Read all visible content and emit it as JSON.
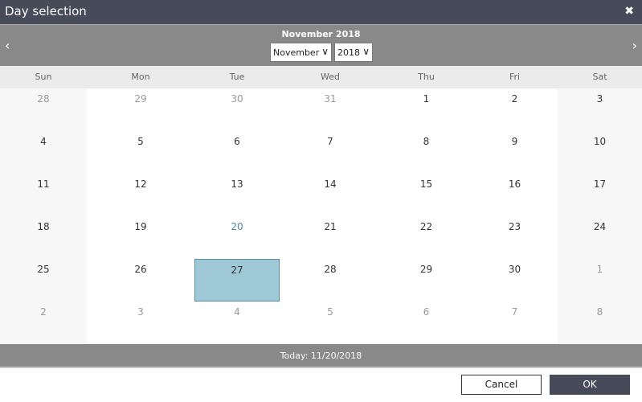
{
  "dialog": {
    "title": "Day selection",
    "close_icon": "close-icon"
  },
  "header": {
    "month_title": "November 2018",
    "month_select": "November",
    "year_select": "2018",
    "prev": "‹",
    "next": "›"
  },
  "weekdays": [
    "Sun",
    "Mon",
    "Tue",
    "Wed",
    "Thu",
    "Fri",
    "Sat"
  ],
  "weeks": [
    [
      {
        "d": "28",
        "o": true
      },
      {
        "d": "29",
        "o": true
      },
      {
        "d": "30",
        "o": true
      },
      {
        "d": "31",
        "o": true
      },
      {
        "d": "1"
      },
      {
        "d": "2"
      },
      {
        "d": "3"
      }
    ],
    [
      {
        "d": "4"
      },
      {
        "d": "5"
      },
      {
        "d": "6"
      },
      {
        "d": "7"
      },
      {
        "d": "8"
      },
      {
        "d": "9"
      },
      {
        "d": "10"
      }
    ],
    [
      {
        "d": "11"
      },
      {
        "d": "12"
      },
      {
        "d": "13"
      },
      {
        "d": "14"
      },
      {
        "d": "15"
      },
      {
        "d": "16"
      },
      {
        "d": "17"
      }
    ],
    [
      {
        "d": "18"
      },
      {
        "d": "19"
      },
      {
        "d": "20",
        "today": true
      },
      {
        "d": "21"
      },
      {
        "d": "22"
      },
      {
        "d": "23"
      },
      {
        "d": "24"
      }
    ],
    [
      {
        "d": "25"
      },
      {
        "d": "26"
      },
      {
        "d": "27",
        "selected": true
      },
      {
        "d": "28"
      },
      {
        "d": "29"
      },
      {
        "d": "30"
      },
      {
        "d": "1",
        "o": true
      }
    ],
    [
      {
        "d": "2",
        "o": true
      },
      {
        "d": "3",
        "o": true
      },
      {
        "d": "4",
        "o": true
      },
      {
        "d": "5",
        "o": true
      },
      {
        "d": "6",
        "o": true
      },
      {
        "d": "7",
        "o": true
      },
      {
        "d": "8",
        "o": true
      }
    ]
  ],
  "footer": {
    "today": "Today: 11/20/2018"
  },
  "buttons": {
    "cancel": "Cancel",
    "ok": "OK"
  },
  "colors": {
    "titlebar": "#474a58",
    "header": "#898989",
    "selected": "#9fc8d6",
    "today": "#4a86a8"
  }
}
